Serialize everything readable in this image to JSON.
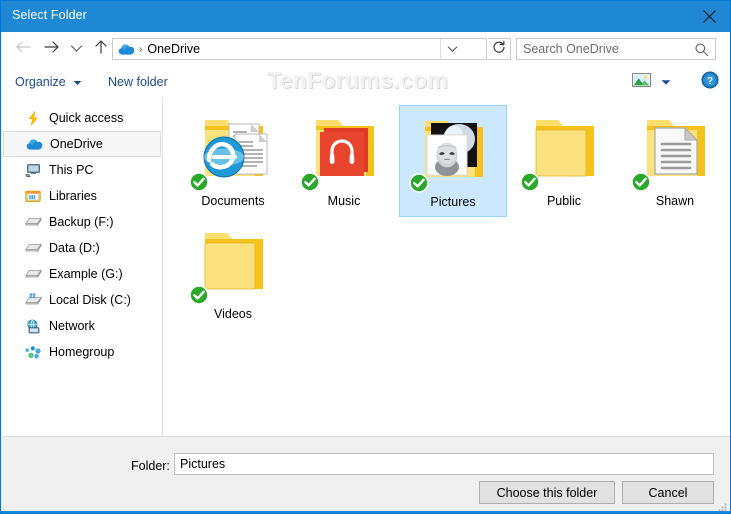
{
  "window": {
    "title": "Select Folder",
    "close_icon": "close-icon"
  },
  "navbar": {
    "back_icon": "arrow-left-icon",
    "forward_icon": "arrow-right-icon",
    "recent_icon": "chevron-down-icon",
    "up_icon": "arrow-up-icon",
    "address": {
      "icon": "onedrive-cloud-icon",
      "separator": "›",
      "path": "OneDrive",
      "dropdown_icon": "chevron-down-icon"
    },
    "refresh_icon": "refresh-icon",
    "search": {
      "placeholder": "Search OneDrive",
      "icon": "search-icon"
    }
  },
  "toolbar": {
    "organize_label": "Organize",
    "organize_caret": "▼",
    "new_folder_label": "New folder",
    "view_icon": "picture-view-icon",
    "view_caret": "▼",
    "help_icon": "help-icon",
    "watermark": "TenForums.com"
  },
  "sidebar": {
    "items": [
      {
        "label": "Quick access",
        "icon": "quick-access-star-icon",
        "selected": false
      },
      {
        "label": "OneDrive",
        "icon": "onedrive-cloud-icon",
        "selected": true
      },
      {
        "label": "This PC",
        "icon": "this-pc-icon",
        "selected": false
      },
      {
        "label": "Libraries",
        "icon": "libraries-icon",
        "selected": false
      },
      {
        "label": "Backup (F:)",
        "icon": "drive-icon",
        "selected": false
      },
      {
        "label": "Data (D:)",
        "icon": "drive-icon",
        "selected": false
      },
      {
        "label": "Example (G:)",
        "icon": "drive-icon",
        "selected": false
      },
      {
        "label": "Local Disk (C:)",
        "icon": "windows-drive-icon",
        "selected": false
      },
      {
        "label": "Network",
        "icon": "network-icon",
        "selected": false
      },
      {
        "label": "Homegroup",
        "icon": "homegroup-icon",
        "selected": false
      }
    ]
  },
  "content": {
    "items": [
      {
        "label": "Documents",
        "icon": "folder-documents-icon",
        "selected": false,
        "synced": true
      },
      {
        "label": "Music",
        "icon": "folder-music-icon",
        "selected": false,
        "synced": true
      },
      {
        "label": "Pictures",
        "icon": "folder-pictures-icon",
        "selected": true,
        "synced": true
      },
      {
        "label": "Public",
        "icon": "folder-empty-icon",
        "selected": false,
        "synced": true
      },
      {
        "label": "Shawn",
        "icon": "folder-document-icon",
        "selected": false,
        "synced": true
      },
      {
        "label": "Videos",
        "icon": "folder-empty-icon",
        "selected": false,
        "synced": true
      }
    ]
  },
  "bottom": {
    "folder_label": "Folder:",
    "folder_value": "Pictures",
    "folder_placeholder": "",
    "choose_label": "Choose this folder",
    "cancel_label": "Cancel"
  },
  "colors": {
    "title_bar": "#1e88d4",
    "selection": "#cce8ff",
    "folder_yellow": "#fce289",
    "accent_link": "#1b4b8f"
  }
}
